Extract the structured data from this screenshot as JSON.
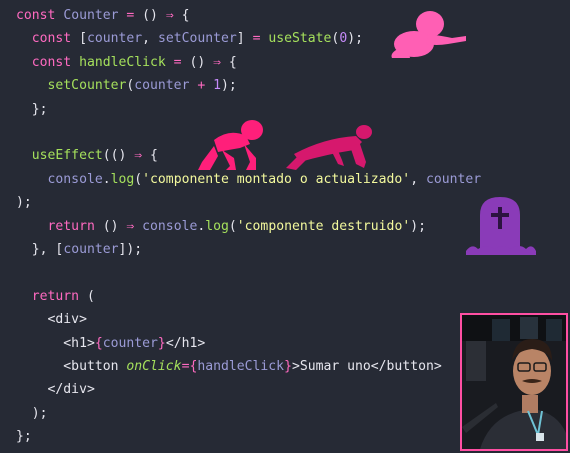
{
  "code": {
    "lines": [
      [
        [
          "kw",
          "const "
        ],
        [
          "vr",
          "Counter"
        ],
        [
          "op",
          " = "
        ],
        [
          "pu",
          "() "
        ],
        [
          "op",
          "⇒"
        ],
        [
          "pu",
          " {"
        ]
      ],
      [
        [
          "kw",
          "  const "
        ],
        [
          "pu",
          "["
        ],
        [
          "vr",
          "counter"
        ],
        [
          "pu",
          ", "
        ],
        [
          "vr",
          "setCounter"
        ],
        [
          "pu",
          "] "
        ],
        [
          "op",
          "="
        ],
        [
          "pu",
          " "
        ],
        [
          "fn",
          "useState"
        ],
        [
          "pu",
          "("
        ],
        [
          "num",
          "0"
        ],
        [
          "pu",
          ");"
        ]
      ],
      [
        [
          "kw",
          "  const "
        ],
        [
          "fn",
          "handleClick"
        ],
        [
          "op",
          " = "
        ],
        [
          "pu",
          "() "
        ],
        [
          "op",
          "⇒"
        ],
        [
          "pu",
          " {"
        ]
      ],
      [
        [
          "fn",
          "    setCounter"
        ],
        [
          "pu",
          "("
        ],
        [
          "vr",
          "counter"
        ],
        [
          "op",
          " + "
        ],
        [
          "num",
          "1"
        ],
        [
          "pu",
          ");"
        ]
      ],
      [
        [
          "pu",
          "  };"
        ]
      ],
      [],
      [
        [
          "fn",
          "  useEffect"
        ],
        [
          "pu",
          "(() "
        ],
        [
          "op",
          "⇒"
        ],
        [
          "pu",
          " {"
        ]
      ],
      [
        [
          "vr",
          "    console"
        ],
        [
          "pu",
          "."
        ],
        [
          "fn",
          "log"
        ],
        [
          "pu",
          "("
        ],
        [
          "str",
          "'componente montado o actualizado'"
        ],
        [
          "pu",
          ", "
        ],
        [
          "vr",
          "counter"
        ]
      ],
      [
        [
          "pu",
          ");"
        ]
      ],
      [
        [
          "kw",
          "    return "
        ],
        [
          "pu",
          "() "
        ],
        [
          "op",
          "⇒"
        ],
        [
          "pu",
          " "
        ],
        [
          "vr",
          "console"
        ],
        [
          "pu",
          "."
        ],
        [
          "fn",
          "log"
        ],
        [
          "pu",
          "("
        ],
        [
          "str",
          "'componente destruido'"
        ],
        [
          "pu",
          ");"
        ]
      ],
      [
        [
          "pu",
          "  }, ["
        ],
        [
          "vr",
          "counter"
        ],
        [
          "pu",
          "]);"
        ]
      ],
      [],
      [
        [
          "kw",
          "  return "
        ],
        [
          "pu",
          "("
        ]
      ],
      [
        [
          "tg",
          "    <div>"
        ]
      ],
      [
        [
          "tg",
          "      <h1>"
        ],
        [
          "op",
          "{"
        ],
        [
          "vr",
          "counter"
        ],
        [
          "op",
          "}"
        ],
        [
          "tg",
          "</h1>"
        ]
      ],
      [
        [
          "tg",
          "      <button "
        ],
        [
          "at",
          "onClick"
        ],
        [
          "op",
          "="
        ],
        [
          "op",
          "{"
        ],
        [
          "vr",
          "handleClick"
        ],
        [
          "op",
          "}"
        ],
        [
          "tg",
          ">Sumar uno</button>"
        ]
      ],
      [
        [
          "tg",
          "    </div>"
        ]
      ],
      [
        [
          "pu",
          "  );"
        ]
      ],
      [
        [
          "pu",
          "};"
        ]
      ]
    ]
  },
  "stickers": {
    "baby_sitting": "baby-sitting-icon",
    "baby_crawling": "baby-crawling-icon",
    "adult_crawling": "adult-crawling-icon",
    "tombstone": "tombstone-icon"
  },
  "colors": {
    "background": "#262a35",
    "keyword": "#ff6ac1",
    "function": "#a5e05c",
    "variable": "#9b9bd6",
    "number": "#c58af9",
    "string": "#f3f99d",
    "sticker_pink": "#ff5fb4",
    "sticker_magenta": "#e0197a",
    "sticker_purple": "#8a3bb8",
    "webcam_border": "#ff4fa3"
  },
  "webcam": {
    "icon": "presenter-webcam"
  }
}
